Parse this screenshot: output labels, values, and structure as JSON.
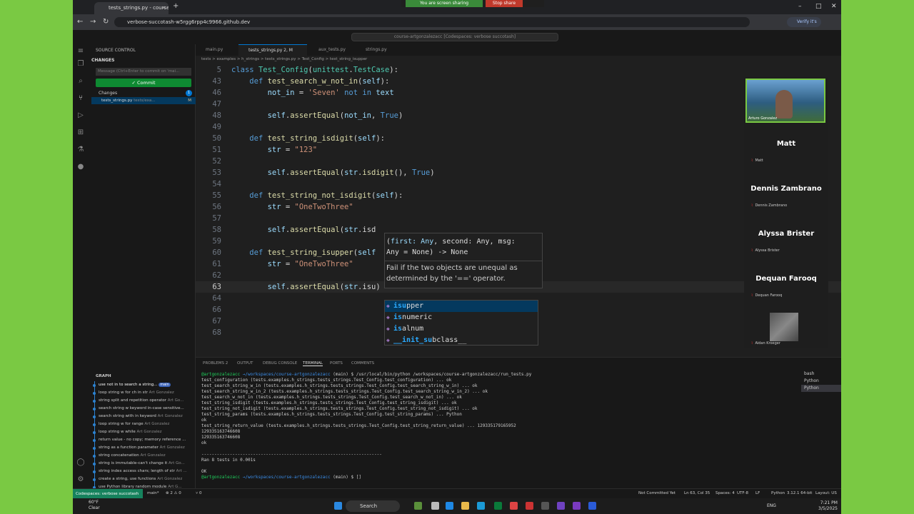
{
  "browser": {
    "tab_title": "tests_strings.py - course-artgonz",
    "tab_close": "×",
    "new_tab": "+",
    "share_message": "You are screen sharing",
    "stop_share": "Stop share",
    "url": "verbose-succotash-w5rgg6rpp4c9966.github.dev",
    "verify": "Verify it's you",
    "min": "–",
    "max": "□",
    "close": "✕"
  },
  "vscode": {
    "command_center": "course-artgonzalezacc [Codespaces: verbose succotash]"
  },
  "sidebar": {
    "title": "SOURCE CONTROL",
    "changes_header": "CHANGES",
    "message_placeholder": "Message (Ctrl+Enter to commit on 'mai...",
    "commit_label": "✓ Commit",
    "changes_label": "Changes",
    "changes_count": "1",
    "file_name": "tests_strings.py",
    "file_path": "tests/exa...",
    "file_status": "M",
    "graph_title": "GRAPH",
    "graph": [
      {
        "msg": "use not in to search a string...",
        "author": "",
        "tag": "main"
      },
      {
        "msg": "loop string w for ch in str",
        "author": "Art Gonzalez"
      },
      {
        "msg": "string split and repetition operator",
        "author": "Art Go..."
      },
      {
        "msg": "search string w keyword in-case sensitive...",
        "author": ""
      },
      {
        "msg": "search string with in keyword",
        "author": "Art Gonzalez"
      },
      {
        "msg": "loop string w for range",
        "author": "Art Gonzalez"
      },
      {
        "msg": "loop string w while",
        "author": "Art Gonzalez"
      },
      {
        "msg": "return value - no copy; memory reference ...",
        "author": ""
      },
      {
        "msg": "string as a function parameter",
        "author": "Art Gonzalez"
      },
      {
        "msg": "string concatenation",
        "author": "Art Gonzalez"
      },
      {
        "msg": "string is immutable-can't change it",
        "author": "Art Go..."
      },
      {
        "msg": "string index access chars; length of str",
        "author": "Art ..."
      },
      {
        "msg": "create a string, use functions",
        "author": "Art Gonzalez"
      },
      {
        "msg": "use Python library random module",
        "author": "Art G..."
      }
    ]
  },
  "editor": {
    "tabs": [
      "main.py",
      "tests_strings.py 2, M",
      "aux_tests.py",
      "strings.py"
    ],
    "breadcrumbs": "tests > examples > h_strings > tests_strings.py > Test_Config > test_string_isupper",
    "sticky": {
      "num": "5",
      "code": "class Test_Config(unittest.TestCase):"
    },
    "lines": [
      {
        "num": "43",
        "code": "    def test_search_w_not_in(self):"
      },
      {
        "num": "46",
        "code": "        not_in = 'Seven' not in text"
      },
      {
        "num": "47",
        "code": ""
      },
      {
        "num": "48",
        "code": "        self.assertEqual(not_in, True)"
      },
      {
        "num": "49",
        "code": ""
      },
      {
        "num": "50",
        "code": "    def test_string_isdigit(self):"
      },
      {
        "num": "51",
        "code": "        str = \"123\""
      },
      {
        "num": "52",
        "code": ""
      },
      {
        "num": "53",
        "code": "        self.assertEqual(str.isdigit(), True)"
      },
      {
        "num": "54",
        "code": ""
      },
      {
        "num": "55",
        "code": "    def test_string_not_isdigit(self):"
      },
      {
        "num": "56",
        "code": "        str = \"OneTwoThree\""
      },
      {
        "num": "57",
        "code": ""
      },
      {
        "num": "58",
        "code": "        self.assertEqual(str.isd"
      },
      {
        "num": "59",
        "code": ""
      },
      {
        "num": "60",
        "code": "    def test_string_isupper(self"
      },
      {
        "num": "61",
        "code": "        str = \"OneTwoThree\""
      },
      {
        "num": "62",
        "code": ""
      },
      {
        "num": "63",
        "code": "        self.assertEqual(str.isu)"
      },
      {
        "num": "64",
        "code": ""
      },
      {
        "num": "66",
        "code": ""
      },
      {
        "num": "67",
        "code": ""
      },
      {
        "num": "68",
        "code": ""
      }
    ],
    "hover": {
      "sig_line1_pre": "(",
      "sig_line1_first": "first: Any",
      "sig_line1_rest": ", second: Any, msg:",
      "sig_line2": "Any = None) -> None",
      "doc_line1": "Fail if the two objects are unequal as",
      "doc_line2": "determined by the '==' operator."
    },
    "suggestions": [
      {
        "match": "isu",
        "rest": "pper"
      },
      {
        "match": "is",
        "rest": "numeric"
      },
      {
        "match": "is",
        "rest": "alnum"
      },
      {
        "match": "__init_su",
        "rest": "bclass__"
      }
    ]
  },
  "people": {
    "presenter": "Arturo Gonzalez",
    "participants": [
      {
        "big": "Matt",
        "small": "Matt"
      },
      {
        "big": "Dennis Zambrano",
        "small": "Dennis Zambrano"
      },
      {
        "big": "Alyssa Brister",
        "small": "Alyssa Brister"
      },
      {
        "big": "Dequan Farooq",
        "small": "Dequan Farooq"
      }
    ],
    "last": "Aidan Kroeger"
  },
  "panel": {
    "tabs": [
      "PROBLEMS",
      "OUTPUT",
      "DEBUG CONSOLE",
      "TERMINAL",
      "PORTS",
      "COMMENTS"
    ],
    "problems_count": "2",
    "terminal": [
      "@artgonzalezacc →/workspaces/course-artgonzalezacc (main) $ /usr/local/bin/python /workspaces/course-artgonzalezacc/run_tests.py",
      "test_configuration (tests.examples.h_strings.tests_strings.Test_Config.test_configuration) ... ok",
      "test_search_string_w_in (tests.examples.h_strings.tests_strings.Test_Config.test_search_string_w_in) ... ok",
      "test_search_string_w_in_2 (tests.examples.h_strings.tests_strings.Test_Config.test_search_string_w_in_2) ... ok",
      "test_search_w_not_in (tests.examples.h_strings.tests_strings.Test_Config.test_search_w_not_in) ... ok",
      "test_string_isdigit (tests.examples.h_strings.tests_strings.Test_Config.test_string_isdigit) ... ok",
      "test_string_not_isdigit (tests.examples.h_strings.tests_strings.Test_Config.test_string_not_isdigit) ... ok",
      "test_string_params (tests.examples.h_strings.tests_strings.Test_Config.test_string_params) ... Python",
      "ok",
      "test_string_return_value (tests.examples.h_strings.tests_strings.Test_Config.test_string_return_value) ... 129335179165952",
      "129335163746608",
      "129335163746608",
      "ok",
      "",
      "----------------------------------------------------------------------",
      "Ran 8 tests in 0.001s",
      "",
      "OK",
      "@artgonzalezacc →/workspaces/course-artgonzalezacc (main) $ []"
    ],
    "shells": [
      "bash",
      "Python",
      "Python"
    ]
  },
  "status": {
    "remote": "Codespaces: verbose succotash",
    "branch": "main*",
    "problems": "⊗ 2 ⚠ 0",
    "ports": "⑂ 0",
    "commit": "Not Committed Yet",
    "position": "Ln 63, Col 35",
    "spaces": "Spaces: 4",
    "encoding": "UTF-8",
    "eol": "LF",
    "lang": "Python",
    "version": "3.12.1 64-bit",
    "layout": "Layout: US"
  },
  "taskbar": {
    "temp": "60°F",
    "weather": "Clear",
    "search": "Search",
    "lang": "ENG",
    "time": "7:21 PM",
    "date": "3/5/2025"
  }
}
